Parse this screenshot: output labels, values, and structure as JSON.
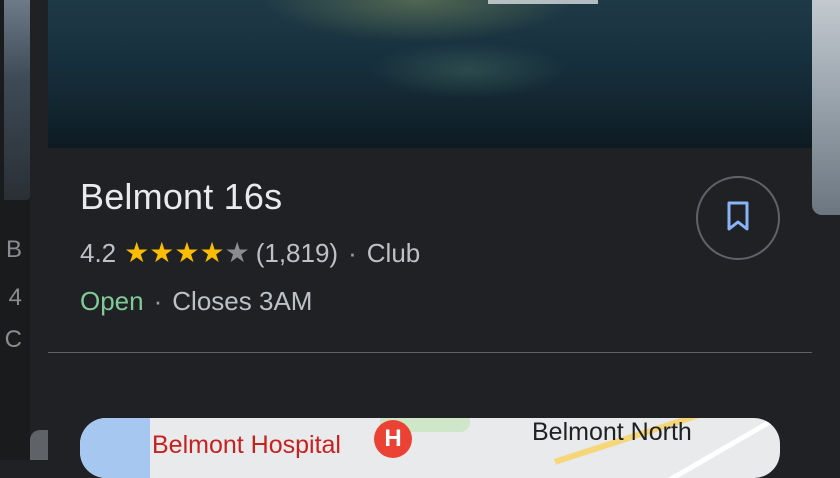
{
  "place": {
    "name": "Belmont 16s",
    "rating": "4.2",
    "stars_filled": 4,
    "stars_total": 5,
    "review_count": "(1,819)",
    "category_separator": "·",
    "category": "Club",
    "status": "Open",
    "hours_separator": "·",
    "hours": "Closes 3AM"
  },
  "save_button": {
    "icon": "bookmark-icon"
  },
  "side_peek": {
    "lines": [
      "B",
      "4",
      "C"
    ]
  },
  "map": {
    "label_hospital": "Belmont Hospital",
    "hospital_marker": "H",
    "label_north": "Belmont North"
  },
  "colors": {
    "background": "#202124",
    "star": "#fbbc04",
    "open": "#81c995",
    "hospital_marker": "#ea4335"
  }
}
